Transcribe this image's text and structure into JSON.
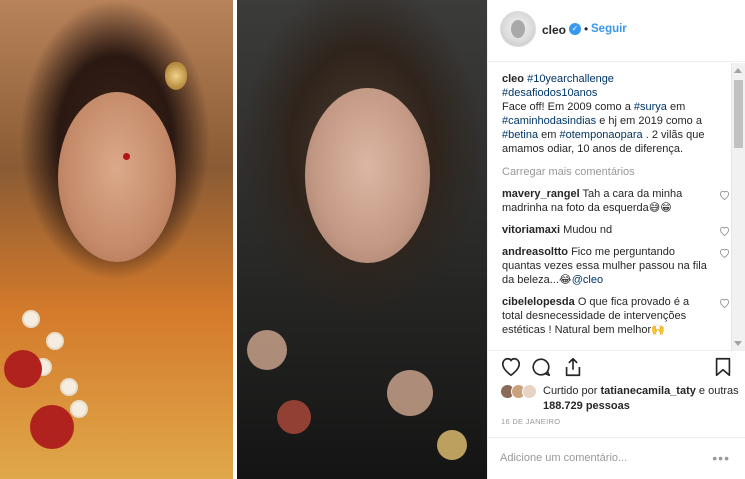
{
  "post": {
    "username": "cleo",
    "follow_label": "Seguir",
    "separator": "•",
    "verified_glyph": "✓"
  },
  "caption": {
    "username": "cleo",
    "line1_tag1": "#10yearchallenge",
    "line2_tag2": "#desafiodos10anos",
    "text_a": "Face off! Em 2009 como a ",
    "tag_surya": "#surya",
    "text_b": " em ",
    "tag_caminho": "#caminhodasindias",
    "text_c": " e hj em 2019 como a ",
    "tag_betina": "#betina",
    "text_d": " em ",
    "tag_otempo": "#otemponaopara",
    "text_e": " . 2 vilãs que amamos odiar, 10 anos de diferença."
  },
  "load_more": "Carregar mais comentários",
  "comments": [
    {
      "user": "mavery_rangel",
      "text": " Tah a cara da minha madrinha na foto da esquerda😅😁"
    },
    {
      "user": "vitoriamaxi",
      "text": " Mudou nd"
    },
    {
      "user": "andreasoltto",
      "text": " Fico me perguntando quantas vezes essa mulher passou na fila da beleza...😂",
      "mention": "@cleo"
    },
    {
      "user": "cibelelopesda",
      "text": " O que fica provado é a total desnecessidade de intervenções estéticas ! Natural bem melhor🙌"
    }
  ],
  "likes": {
    "prefix": "Curtido por ",
    "user": "tatianecamila_taty",
    "suffix": " e outras ",
    "count": "188.729",
    "tail": " pessoas"
  },
  "date": "16 DE JANEIRO",
  "add_comment": {
    "placeholder": "Adicione um comentário..."
  },
  "more_glyph": "•••",
  "icons": {
    "like": "heart-icon",
    "comment": "comment-bubble-icon",
    "share": "share-icon",
    "save": "bookmark-icon"
  },
  "colors": {
    "link": "#3897f0",
    "hashtag": "#003569",
    "muted": "#999999",
    "text": "#262626"
  }
}
